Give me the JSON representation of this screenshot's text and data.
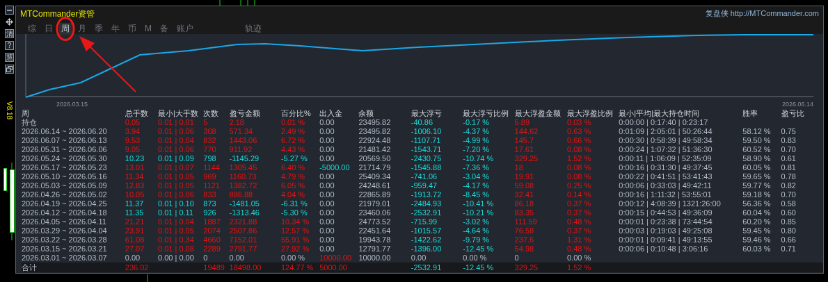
{
  "toolbar": [
    {
      "kind": "minimize"
    },
    {
      "kind": "move"
    },
    {
      "kind": "text",
      "label": "清"
    },
    {
      "kind": "text",
      "label": "?"
    },
    {
      "kind": "text",
      "label": "慧"
    },
    {
      "kind": "restore"
    }
  ],
  "version": "V8.18",
  "window": {
    "title": "MTCommander资管",
    "site": "复盘侠 http://MTCommander.com"
  },
  "tabs": [
    {
      "label": "综",
      "selected": false
    },
    {
      "label": "日",
      "selected": false
    },
    {
      "label": "周",
      "selected": true
    },
    {
      "label": "月",
      "selected": false
    },
    {
      "label": "季",
      "selected": false
    },
    {
      "label": "年",
      "selected": false
    },
    {
      "label": "币",
      "selected": false
    },
    {
      "label": "M",
      "selected": false
    },
    {
      "label": "备",
      "selected": false
    },
    {
      "label": "账户",
      "selected": false
    },
    {
      "label": "轨迹",
      "selected": false
    }
  ],
  "chart": {
    "start_label": "2026.03.15",
    "end_label": "2026.06.14"
  },
  "table": {
    "columns": [
      {
        "label": "周",
        "kind": "plain"
      },
      {
        "label": "总手数",
        "kind": "result"
      },
      {
        "label": "最小|大手数",
        "kind": "result"
      },
      {
        "label": "次数",
        "kind": "result"
      },
      {
        "label": "盈亏金额",
        "kind": "result"
      },
      {
        "label": "百分比%",
        "kind": "result"
      },
      {
        "label": "出入金",
        "kind": "deposit"
      },
      {
        "label": "余额",
        "kind": "plain"
      },
      {
        "label": "最大浮亏",
        "kind": "drawdown"
      },
      {
        "label": "最大浮亏比例",
        "kind": "drawdown"
      },
      {
        "label": "最大浮盈金额",
        "kind": "runup"
      },
      {
        "label": "最大浮盈比例",
        "kind": "runup"
      },
      {
        "label": "最小|平均|最大持仓时间",
        "kind": "plain"
      },
      {
        "label": "胜率",
        "kind": "plain"
      },
      {
        "label": "盈亏比",
        "kind": "plain"
      }
    ],
    "rows": [
      {
        "kind": "position",
        "negative": false,
        "zero": false,
        "deposit_negative": false,
        "deposit_zero": true,
        "cells": [
          "持仓",
          "0.05",
          "0.01 | 0.01",
          "5",
          "2.18",
          "0.01 %",
          "0.00",
          "23495.82",
          "-40.86",
          "-0.17 %",
          "5.89",
          "0.03 %",
          "0:00:00 | 0:17:40 | 0:23:17",
          null,
          null
        ]
      },
      {
        "kind": "week",
        "negative": false,
        "zero": false,
        "deposit_negative": false,
        "deposit_zero": true,
        "cells": [
          "2026.06.14 ~ 2026.06.20",
          "3.94",
          "0.01 | 0.06",
          "308",
          "571.34",
          "2.49 %",
          "0.00",
          "23495.82",
          "-1006.10",
          "-4.37 %",
          "144.62",
          "0.63 %",
          "0:01:09 | 2:05:01 | 50:26:44",
          "58.12 %",
          "0.75"
        ]
      },
      {
        "kind": "week",
        "negative": false,
        "zero": false,
        "deposit_negative": false,
        "deposit_zero": true,
        "cells": [
          "2026.06.07 ~ 2026.06.13",
          "9.53",
          "0.01 | 0.04",
          "832",
          "1443.06",
          "6.72 %",
          "0.00",
          "22924.48",
          "-1107.71",
          "-4.99 %",
          "145.7",
          "0.66 %",
          "0:00:30 | 0:58:39 | 49:58:34",
          "59.50 %",
          "0.83"
        ]
      },
      {
        "kind": "week",
        "negative": false,
        "zero": false,
        "deposit_negative": false,
        "deposit_zero": true,
        "cells": [
          "2026.05.31 ~ 2026.06.06",
          "9.05",
          "0.01 | 0.06",
          "770",
          "911.92",
          "4.43 %",
          "0.00",
          "21481.42",
          "-1543.71",
          "-7.20 %",
          "17.61",
          "0.08 %",
          "0:00:24 | 1:07:32 | 51:36:30",
          "60.52 %",
          "0.70"
        ]
      },
      {
        "kind": "week",
        "negative": true,
        "zero": false,
        "deposit_negative": false,
        "deposit_zero": true,
        "cells": [
          "2026.05.24 ~ 2026.05.30",
          "10.23",
          "0.01 | 0.09",
          "798",
          "-1145.29",
          "-5.27 %",
          "0.00",
          "20569.50",
          "-2430.75",
          "-10.74 %",
          "329.25",
          "1.52 %",
          "0:00:11 | 1:06:09 | 52:35:09",
          "58.90 %",
          "0.61"
        ]
      },
      {
        "kind": "week",
        "negative": false,
        "zero": false,
        "deposit_negative": true,
        "deposit_zero": false,
        "cells": [
          "2026.05.17 ~ 2026.05.23",
          "13.01",
          "0.01 | 0.07",
          "1144",
          "1305.45",
          "6.40 %",
          "-5000.00",
          "21714.79",
          "-1545.88",
          "-7.36 %",
          "18",
          "0.08 %",
          "0:00:16 | 0:31:30 | 49:37:45",
          "60.05 %",
          "0.81"
        ]
      },
      {
        "kind": "week",
        "negative": false,
        "zero": false,
        "deposit_negative": false,
        "deposit_zero": true,
        "cells": [
          "2026.05.10 ~ 2026.05.16",
          "11.34",
          "0.01 | 0.05",
          "969",
          "1160.73",
          "4.79 %",
          "0.00",
          "25409.34",
          "-741.06",
          "-3.04 %",
          "19.91",
          "0.08 %",
          "0:00:22 | 0:41:51 | 53:41:43",
          "59.65 %",
          "0.78"
        ]
      },
      {
        "kind": "week",
        "negative": false,
        "zero": false,
        "deposit_negative": false,
        "deposit_zero": true,
        "cells": [
          "2026.05.03 ~ 2026.05.09",
          "12.83",
          "0.01 | 0.05",
          "1121",
          "1382.72",
          "6.05 %",
          "0.00",
          "24248.61",
          "-959.47",
          "-4.17 %",
          "59.08",
          "0.25 %",
          "0:00:06 | 0:33:03 | 49:42:11",
          "59.77 %",
          "0.82"
        ]
      },
      {
        "kind": "week",
        "negative": false,
        "zero": false,
        "deposit_negative": false,
        "deposit_zero": true,
        "cells": [
          "2026.04.26 ~ 2026.05.02",
          "10.05",
          "0.01 | 0.06",
          "833",
          "886.88",
          "4.04 %",
          "0.00",
          "22865.89",
          "-1913.72",
          "-8.45 %",
          "32.41",
          "0.14 %",
          "0:00:16 | 1:11:32 | 53:55:01",
          "59.18 %",
          "0.70"
        ]
      },
      {
        "kind": "week",
        "negative": true,
        "zero": false,
        "deposit_negative": false,
        "deposit_zero": true,
        "cells": [
          "2026.04.19 ~ 2026.04.25",
          "11.37",
          "0.01 | 0.10",
          "873",
          "-1481.05",
          "-6.31 %",
          "0.00",
          "21979.01",
          "-2484.93",
          "-10.41 %",
          "86.18",
          "0.37 %",
          "0:00:12 | 4:08:39 | 1321:26:00",
          "56.36 %",
          "0.58"
        ]
      },
      {
        "kind": "week",
        "negative": true,
        "zero": false,
        "deposit_negative": false,
        "deposit_zero": true,
        "cells": [
          "2026.04.12 ~ 2026.04.18",
          "11.35",
          "0.01 | 0.11",
          "926",
          "-1313.46",
          "-5.30 %",
          "0.00",
          "23460.06",
          "-2532.91",
          "-10.21 %",
          "83.35",
          "0.37 %",
          "0:00:15 | 0:44:53 | 49:36:09",
          "60.04 %",
          "0.60"
        ]
      },
      {
        "kind": "week",
        "negative": false,
        "zero": false,
        "deposit_negative": false,
        "deposit_zero": true,
        "cells": [
          "2026.04.05 ~ 2026.04.11",
          "21.21",
          "0.01 | 0.04",
          "1887",
          "2321.88",
          "10.34 %",
          "0.00",
          "24773.52",
          "-715.99",
          "-3.02 %",
          "111.59",
          "0.48 %",
          "0:00:01 | 0:23:38 | 73:44:54",
          "60.20 %",
          "0.85"
        ]
      },
      {
        "kind": "week",
        "negative": false,
        "zero": false,
        "deposit_negative": false,
        "deposit_zero": true,
        "cells": [
          "2026.03.29 ~ 2026.04.04",
          "23.91",
          "0.01 | 0.05",
          "2074",
          "2507.86",
          "12.57 %",
          "0.00",
          "22451.64",
          "-1015.57",
          "-4.64 %",
          "76.58",
          "0.37 %",
          "0:00:03 | 0:19:03 | 49:25:08",
          "59.45 %",
          "0.80"
        ]
      },
      {
        "kind": "week",
        "negative": false,
        "zero": false,
        "deposit_negative": false,
        "deposit_zero": true,
        "cells": [
          "2026.03.22 ~ 2026.03.28",
          "61.08",
          "0.01 | 0.34",
          "4660",
          "7152.01",
          "55.91 %",
          "0.00",
          "19943.78",
          "-1422.62",
          "-9.79 %",
          "237.6",
          "1.31 %",
          "0:00:01 | 0:09:41 | 49:13:55",
          "59.46 %",
          "0.66"
        ]
      },
      {
        "kind": "week",
        "negative": false,
        "zero": false,
        "deposit_negative": false,
        "deposit_zero": true,
        "cells": [
          "2026.03.15 ~ 2026.03.21",
          "27.07",
          "0.01 | 0.08",
          "2289",
          "2791.77",
          "27.92 %",
          "0.00",
          "12791.77",
          "-1396.00",
          "-12.45 %",
          "54.98",
          "0.48 %",
          "0:00:06 | 0:10:48 | 3:06:16",
          "60.03 %",
          "0.71"
        ]
      },
      {
        "kind": "week",
        "negative": false,
        "zero": true,
        "deposit_negative": false,
        "deposit_zero": false,
        "cells": [
          "2026.03.01 ~ 2026.03.07",
          "0.00",
          "0.00 | 0.00",
          "0",
          "0.00",
          "0.00 %",
          "10000.00",
          "10000.00",
          "0.00",
          "0.00 %",
          "0",
          "0.00 %",
          null,
          null,
          null
        ]
      },
      {
        "kind": "total",
        "negative": false,
        "zero": false,
        "deposit_negative": false,
        "deposit_zero": false,
        "cells": [
          "合计",
          "236.02",
          null,
          "19489",
          "18498.00",
          "124.77 %",
          "5000.00",
          null,
          "-2532.91",
          "-12.45 %",
          "329.25",
          "1.52 %",
          null,
          null,
          null
        ]
      }
    ]
  }
}
